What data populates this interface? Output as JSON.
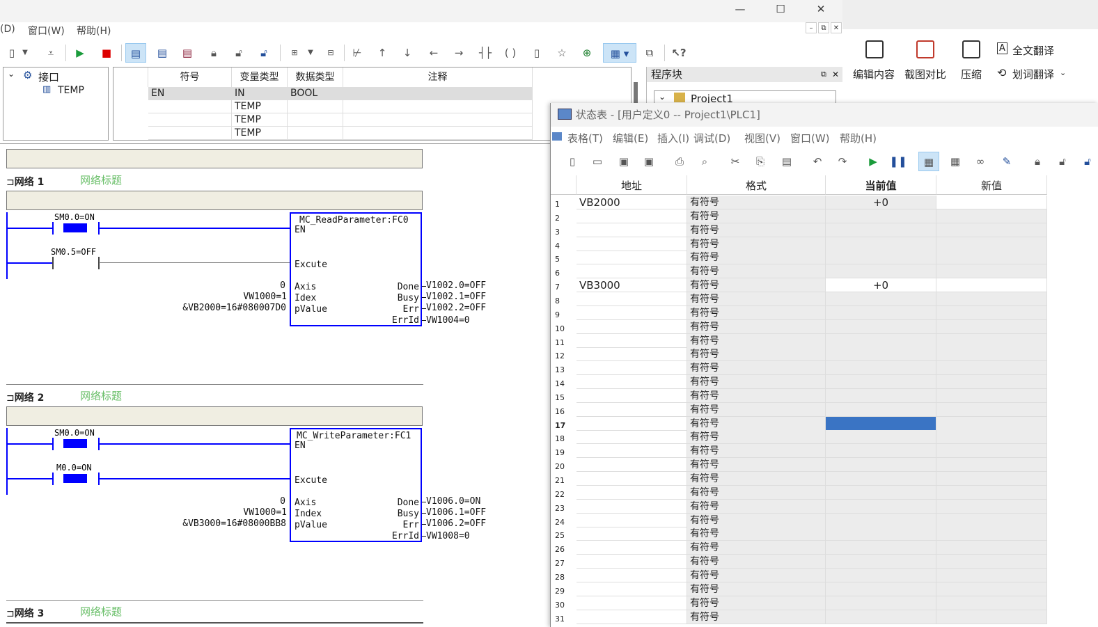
{
  "main": {
    "menu": [
      "(D)",
      "窗口(W)",
      "帮助(H)"
    ],
    "window_controls": {
      "minimize": "—",
      "maximize": "☐",
      "close": "✕"
    },
    "mdi_controls": {
      "minimize": "–",
      "restore": "⧉",
      "close": "✕"
    },
    "tree": {
      "root": "接口",
      "child": "TEMP"
    },
    "var_table": {
      "headers": [
        "符号",
        "变量类型",
        "数据类型",
        "注释"
      ],
      "rows": [
        {
          "symbol": "EN",
          "vartype": "IN",
          "datatype": "BOOL"
        },
        {
          "symbol": "",
          "vartype": "TEMP",
          "datatype": ""
        },
        {
          "symbol": "",
          "vartype": "TEMP",
          "datatype": ""
        },
        {
          "symbol": "",
          "vartype": "TEMP",
          "datatype": ""
        }
      ]
    },
    "program_block": {
      "title": "程序块",
      "project": "Project1"
    }
  },
  "networks": [
    {
      "label": "网络 1",
      "title": "网络标题",
      "contact1": "SM0.0=ON",
      "contact2": "SM0.5=OFF",
      "fb_name": "MC_ReadParameter:FC0",
      "en": "EN",
      "excute": "Excute",
      "in_pins": [
        "Axis",
        "Idex",
        "pValue"
      ],
      "in_vals": [
        "0",
        "VW1000=1",
        "&VB2000=16#080007D0"
      ],
      "out_pins": [
        "Done",
        "Busy",
        "Err",
        "ErrId"
      ],
      "out_vals": [
        "V1002.0=OFF",
        "V1002.1=OFF",
        "V1002.2=OFF",
        "VW1004=0"
      ]
    },
    {
      "label": "网络 2",
      "title": "网络标题",
      "contact1": "SM0.0=ON",
      "contact2": "M0.0=ON",
      "fb_name": "MC_WriteParameter:FC1",
      "en": "EN",
      "excute": "Excute",
      "in_pins": [
        "Axis",
        "Index",
        "pValue"
      ],
      "in_vals": [
        "0",
        "VW1000=1",
        "&VB3000=16#08000BB8"
      ],
      "out_pins": [
        "Done",
        "Busy",
        "Err",
        "ErrId"
      ],
      "out_vals": [
        "V1006.0=ON",
        "V1006.1=OFF",
        "V1006.2=OFF",
        "VW1008=0"
      ]
    },
    {
      "label": "网络 3",
      "title": "网络标题"
    }
  ],
  "translator": {
    "edit": "编辑内容",
    "compare": "截图对比",
    "compress": "压缩",
    "full_translate": "全文翻译",
    "word_translate": "划词翻译"
  },
  "status_table": {
    "title": "状态表 - [用户定义0 -- Project1\\PLC1]",
    "menu": [
      "表格(T)",
      "编辑(E)",
      "插入(I)",
      "调试(D)",
      "视图(V)",
      "窗口(W)",
      "帮助(H)"
    ],
    "headers": [
      "地址",
      "格式",
      "当前值",
      "新值"
    ],
    "format_value": "有符号",
    "rows": [
      {
        "n": "1",
        "addr": "VB2000",
        "cur": "+0"
      },
      {
        "n": "2"
      },
      {
        "n": "3"
      },
      {
        "n": "4"
      },
      {
        "n": "5"
      },
      {
        "n": "6"
      },
      {
        "n": "7",
        "addr": "VB3000",
        "cur": "+0"
      },
      {
        "n": "8"
      },
      {
        "n": "9"
      },
      {
        "n": "10"
      },
      {
        "n": "11"
      },
      {
        "n": "12"
      },
      {
        "n": "13"
      },
      {
        "n": "14"
      },
      {
        "n": "15"
      },
      {
        "n": "16"
      },
      {
        "n": "17",
        "selected": true
      },
      {
        "n": "18"
      },
      {
        "n": "19"
      },
      {
        "n": "20"
      },
      {
        "n": "21"
      },
      {
        "n": "22"
      },
      {
        "n": "23"
      },
      {
        "n": "24"
      },
      {
        "n": "25"
      },
      {
        "n": "26"
      },
      {
        "n": "27"
      },
      {
        "n": "28"
      },
      {
        "n": "29"
      },
      {
        "n": "30"
      },
      {
        "n": "31"
      }
    ]
  },
  "colors": {
    "wire_on": "#0000ff",
    "selected_cell": "#3a74c4",
    "network_title": "#6abf69"
  }
}
